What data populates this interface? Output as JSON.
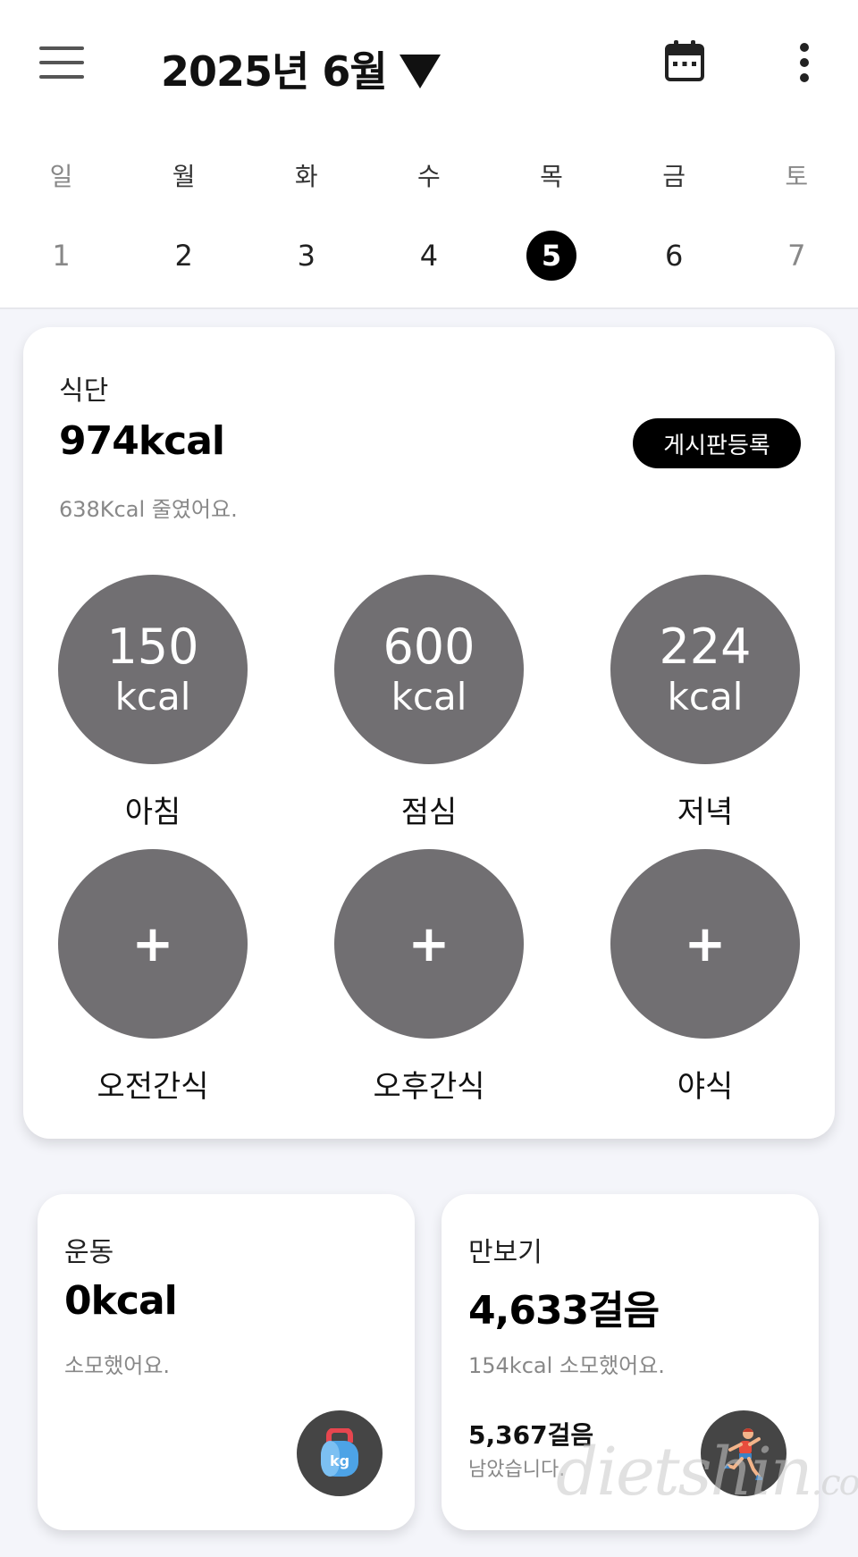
{
  "header": {
    "month_title": "2025년 6월"
  },
  "week": {
    "days_of_week": [
      "일",
      "월",
      "화",
      "수",
      "목",
      "금",
      "토"
    ],
    "dates": [
      "1",
      "2",
      "3",
      "4",
      "5",
      "6",
      "7"
    ],
    "selected_index": 4
  },
  "diet": {
    "label": "식단",
    "total": "974kcal",
    "board_button": "게시판등록",
    "reduced_text": "638Kcal 줄였어요.",
    "meals": [
      {
        "name": "아침",
        "value": "150",
        "unit": "kcal"
      },
      {
        "name": "점심",
        "value": "600",
        "unit": "kcal"
      },
      {
        "name": "저녁",
        "value": "224",
        "unit": "kcal"
      },
      {
        "name": "오전간식",
        "plus": "+"
      },
      {
        "name": "오후간식",
        "plus": "+"
      },
      {
        "name": "야식",
        "plus": "+"
      }
    ]
  },
  "exercise": {
    "label": "운동",
    "total": "0kcal",
    "sub": "소모했어요."
  },
  "steps": {
    "label": "만보기",
    "total": "4,633걸음",
    "sub": "154kcal 소모했어요.",
    "remain_value": "5,367걸음",
    "remain_text": "남았습니다."
  },
  "watermark": {
    "main": "dietshin",
    "suffix": ".com"
  },
  "colors": {
    "meal_circle": "#716f72",
    "fab": "#454545",
    "accent": "#000000"
  }
}
